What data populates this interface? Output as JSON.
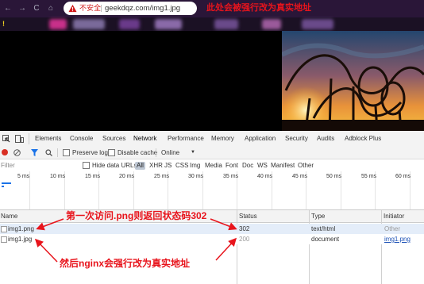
{
  "browser": {
    "insecure_label": "不安全",
    "url": "geekdqz.com/img1.jpg",
    "top_annotation": "此处会被强行改为真实地址",
    "yellow_mark": "!"
  },
  "devtools": {
    "tabs": [
      "Elements",
      "Console",
      "Sources",
      "Network",
      "Performance",
      "Memory",
      "Application",
      "Security",
      "Audits",
      "Adblock Plus"
    ],
    "active_tab": "Network",
    "toolbar": {
      "preserve_log": "Preserve log",
      "disable_cache": "Disable cache",
      "throttle": "Online",
      "throttle_arrow": "▼"
    },
    "filter": {
      "placeholder": "Filter",
      "hide_data_urls": "Hide data URLs",
      "types": [
        "All",
        "XHR",
        "JS",
        "CSS",
        "Img",
        "Media",
        "Font",
        "Doc",
        "WS",
        "Manifest",
        "Other"
      ]
    },
    "timeline_ticks": [
      "5 ms",
      "10 ms",
      "15 ms",
      "20 ms",
      "25 ms",
      "30 ms",
      "35 ms",
      "40 ms",
      "45 ms",
      "50 ms",
      "55 ms",
      "60 ms"
    ],
    "columns": {
      "name": "Name",
      "status": "Status",
      "type": "Type",
      "initiator": "Initiator"
    },
    "rows": [
      {
        "name": "img1.png",
        "status": "302",
        "type": "text/html",
        "initiator": "Other"
      },
      {
        "name": "img1.jpg",
        "status": "200",
        "type": "document",
        "initiator": "img1.png"
      }
    ]
  },
  "annotations": {
    "first": "第一次访问.png则返回状态码302",
    "second": "然后nginx会强行改为真实地址"
  },
  "colors": {
    "annotation": "#e8141c",
    "accent": "#1a73e8",
    "selected_row": "#e4edf9"
  }
}
